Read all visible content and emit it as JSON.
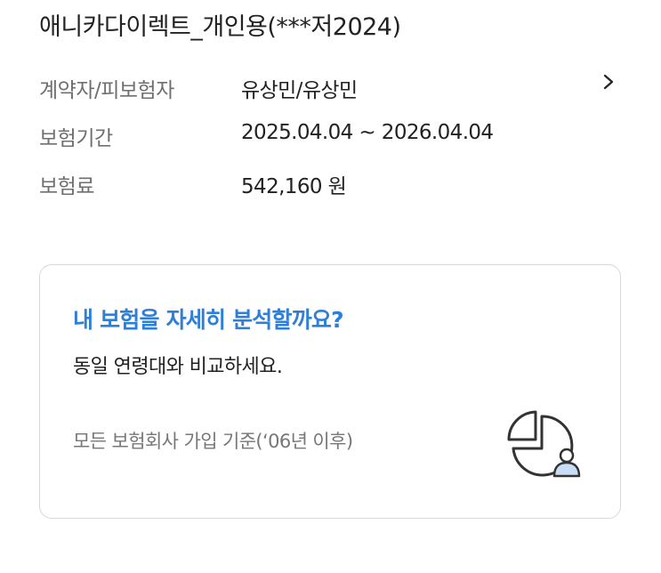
{
  "policy": {
    "title": "애니카다이렉트_개인용(***저2024)",
    "rows": [
      {
        "label": "계약자/피보험자",
        "value": "유상민/유상민"
      },
      {
        "label": "보험기간",
        "value": "2025.04.04 ~ 2026.04.04"
      },
      {
        "label": "보험료",
        "value": "542,160 원"
      }
    ],
    "detail_icon": "chevron-right-icon"
  },
  "analysis_card": {
    "title": "내 보험을 자세히 분석할까요?",
    "subtitle": "동일 연령대와 비교하세요.",
    "note": "모든 보험회사 가입 기준(‘06년 이후)",
    "icon": "pie-chart-user-icon",
    "accent_color": "#2f7ed8"
  }
}
